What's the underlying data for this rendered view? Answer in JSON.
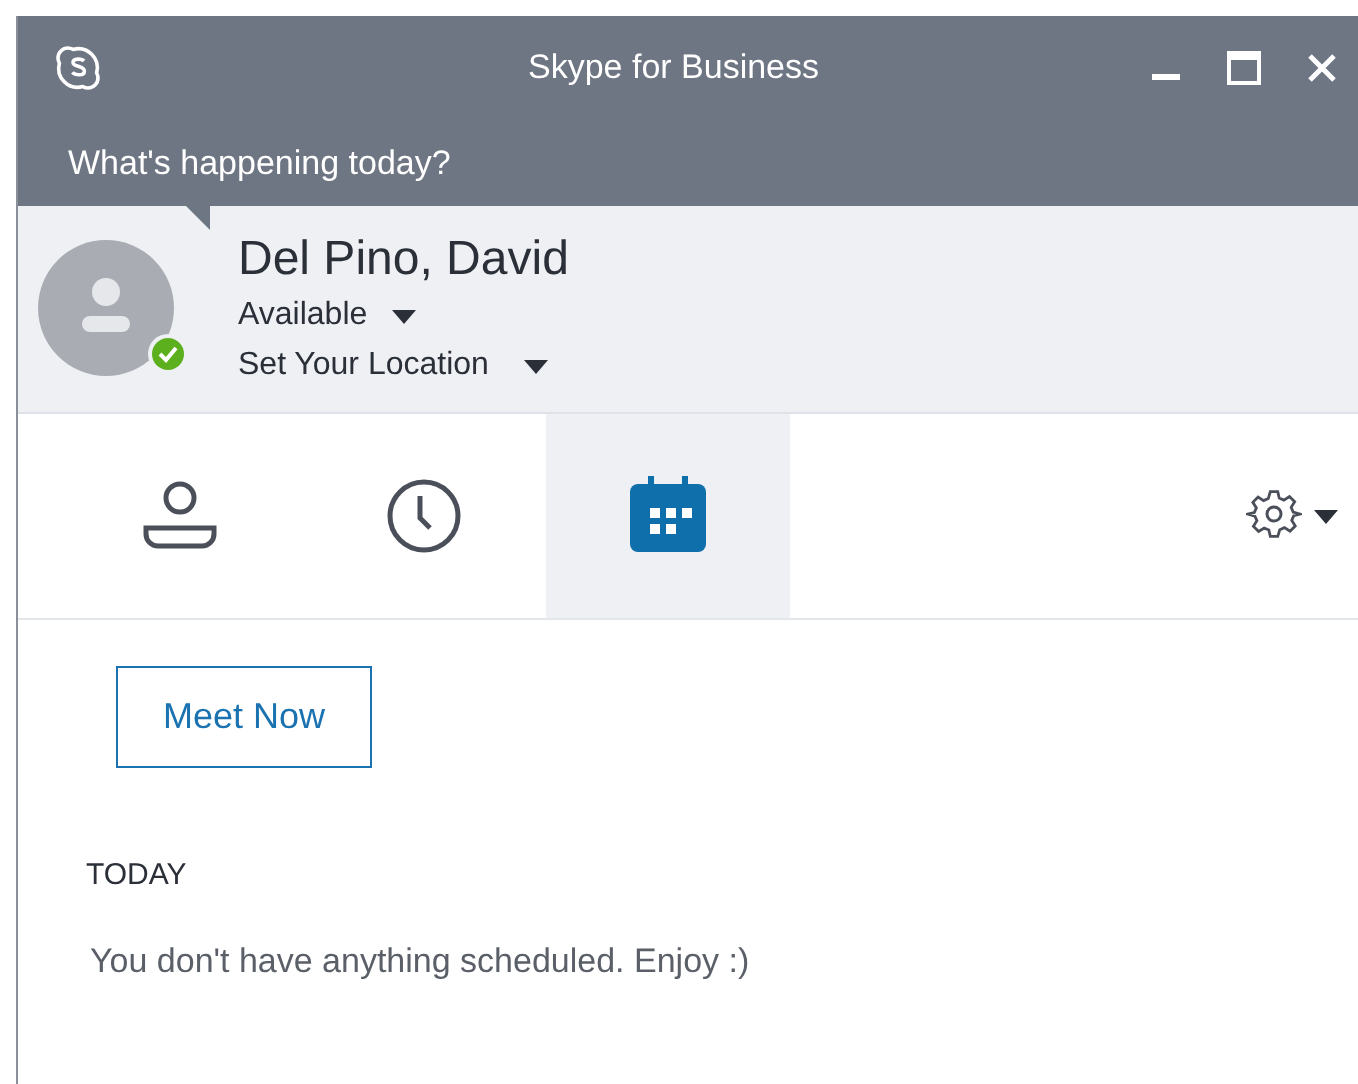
{
  "window": {
    "title": "Skype for Business"
  },
  "note": {
    "placeholder": "What's happening today?"
  },
  "profile": {
    "name": "Del Pino, David",
    "presence": "Available",
    "online": true,
    "location": "Set Your Location"
  },
  "tabs": [
    {
      "kind": "contacts",
      "selected": false
    },
    {
      "kind": "recent",
      "selected": false
    },
    {
      "kind": "meetings",
      "selected": true
    }
  ],
  "meet_now": "Meet Now",
  "section": {
    "heading": "TODAY",
    "message": "You don't have anything scheduled. Enjoy :)"
  }
}
